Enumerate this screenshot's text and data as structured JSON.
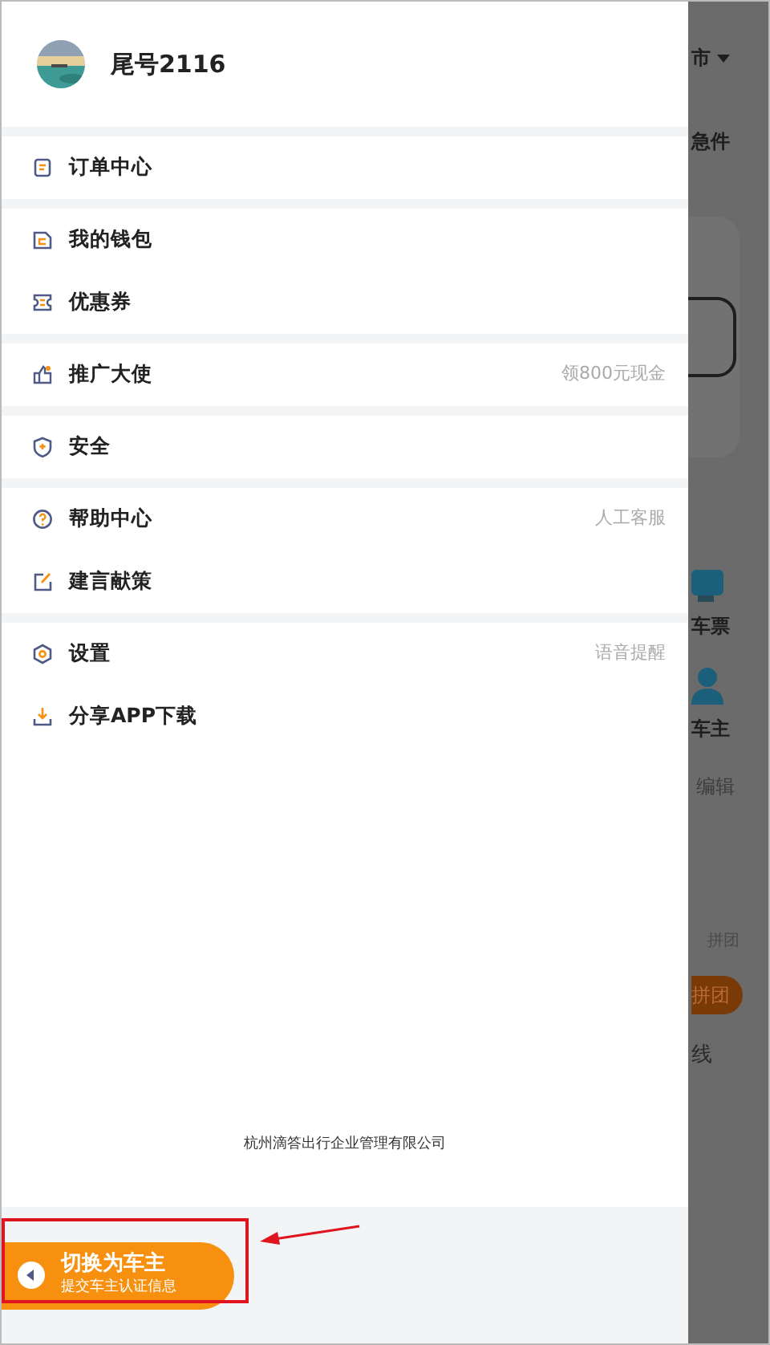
{
  "user": {
    "name": "尾号2116"
  },
  "menu_groups": [
    {
      "items": [
        {
          "kind": "order",
          "label": "订单中心"
        }
      ]
    },
    {
      "items": [
        {
          "kind": "wallet",
          "label": "我的钱包"
        },
        {
          "kind": "coupon",
          "label": "优惠券"
        }
      ]
    },
    {
      "items": [
        {
          "kind": "promote",
          "label": "推广大使",
          "hint": "领800元现金"
        }
      ]
    },
    {
      "items": [
        {
          "kind": "security",
          "label": "安全"
        }
      ]
    },
    {
      "items": [
        {
          "kind": "help",
          "label": "帮助中心",
          "hint": "人工客服"
        },
        {
          "kind": "feedback",
          "label": "建言献策"
        }
      ]
    },
    {
      "items": [
        {
          "kind": "settings",
          "label": "设置",
          "hint": "语音提醒"
        },
        {
          "kind": "download",
          "label": "分享APP下载"
        }
      ]
    }
  ],
  "company": "杭州滴答出行企业管理有限公司",
  "switch_button": {
    "title": "切换为车主",
    "subtitle": "提交车主认证信息"
  },
  "background_page": [
    {
      "kind": "city",
      "text": "市"
    },
    {
      "kind": "label",
      "text": "急件"
    },
    {
      "kind": "box"
    },
    {
      "kind": "ticket",
      "text": "车票"
    },
    {
      "kind": "driver",
      "text": "车主"
    },
    {
      "kind": "edit",
      "text": "编辑"
    },
    {
      "kind": "faint",
      "text": "拼团"
    },
    {
      "kind": "orange",
      "text": "拼团"
    },
    {
      "kind": "link",
      "text": "线"
    }
  ]
}
